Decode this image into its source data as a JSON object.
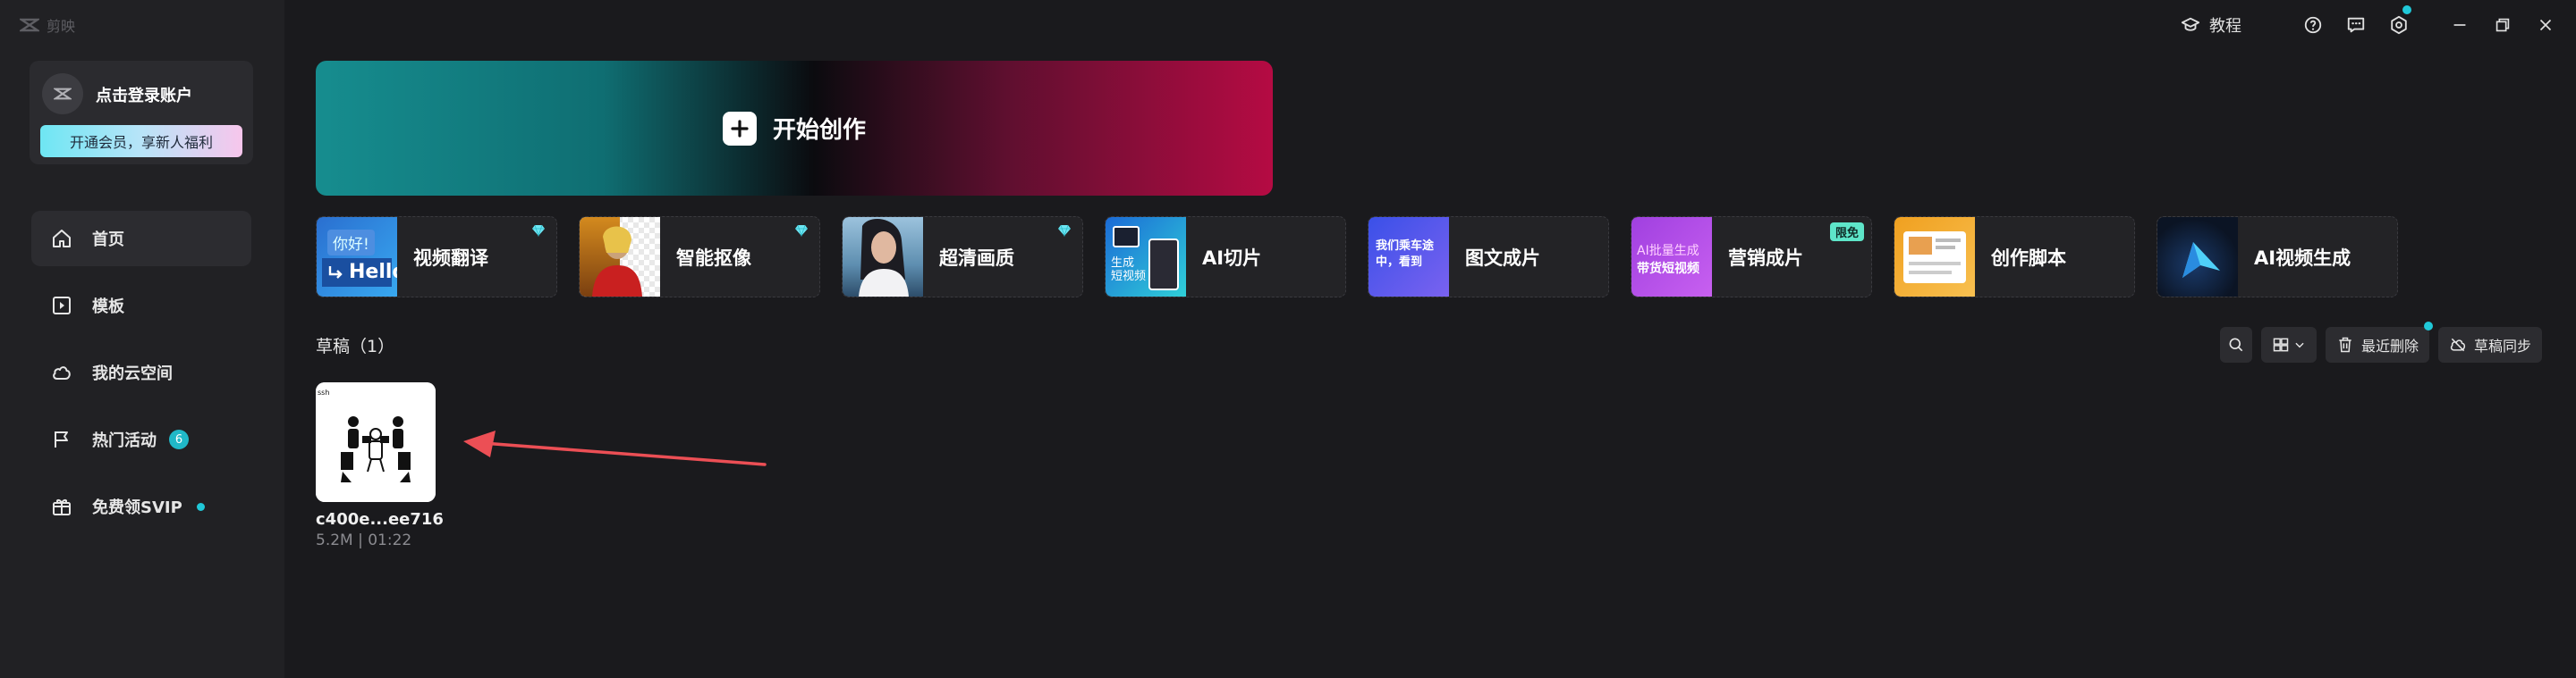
{
  "app": {
    "name": "剪映"
  },
  "sidebar": {
    "login_text": "点击登录账户",
    "vip_button": "开通会员，享新人福利",
    "items": [
      {
        "label": "首页",
        "icon": "home-icon",
        "active": true
      },
      {
        "label": "模板",
        "icon": "template-icon"
      },
      {
        "label": "我的云空间",
        "icon": "cloud-icon"
      },
      {
        "label": "热门活动",
        "icon": "flag-icon",
        "badge": "6"
      },
      {
        "label": "免费领SVIP",
        "icon": "gift-icon",
        "dot": true
      }
    ]
  },
  "titlebar": {
    "tutorial_label": "教程"
  },
  "hero": {
    "label": "开始创作"
  },
  "features": [
    {
      "label": "视频翻译",
      "icon": "diamond-icon",
      "thumb_text": [
        "你好!",
        "Hello"
      ]
    },
    {
      "label": "智能抠像",
      "icon": "diamond-icon"
    },
    {
      "label": "超清画质",
      "icon": "diamond-icon"
    },
    {
      "label": "AI切片",
      "thumb_text": [
        "生成",
        "短视频"
      ]
    },
    {
      "label": "图文成片",
      "thumb_text": [
        "我们乘车途",
        "中，看到"
      ]
    },
    {
      "label": "营销成片",
      "badge": "限免",
      "thumb_text": [
        "AI批量生成",
        "带货短视频"
      ]
    },
    {
      "label": "创作脚本"
    },
    {
      "label": "AI视频生成"
    }
  ],
  "drafts": {
    "title": "草稿（1）",
    "tools": {
      "recent_delete": "最近删除",
      "sync": "草稿同步"
    },
    "items": [
      {
        "name": "c400e...ee716",
        "meta": "5.2M | 01:22"
      }
    ]
  },
  "colors": {
    "accent": "#20c8d8",
    "background": "#1a1a1d",
    "sidebar": "#212124"
  }
}
